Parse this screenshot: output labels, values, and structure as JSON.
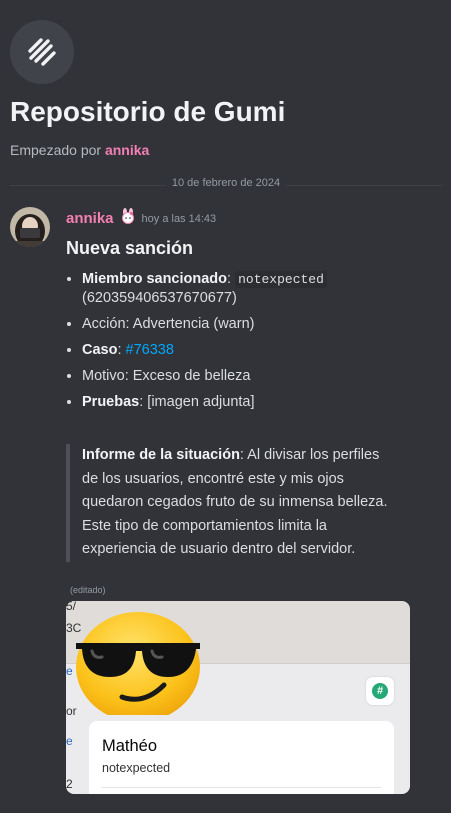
{
  "thread": {
    "title": "Repositorio de Gumi",
    "started_prefix": "Empezado por ",
    "started_author": "annika"
  },
  "divider_date": "10 de febrero de 2024",
  "message": {
    "author": "annika",
    "timestamp": "hoy a las 14:43",
    "heading": "Nueva sanción",
    "items": [
      {
        "label": "Miembro sancionado",
        "sep": ":",
        "code": "notexpected",
        "extra": "(620359406537670677)"
      },
      {
        "text": "Acción: Advertencia (warn)"
      },
      {
        "label": "Caso",
        "sep": ": ",
        "link": "#76338"
      },
      {
        "text": "Motivo: Exceso de belleza"
      },
      {
        "label": "Pruebas",
        "sep": ": ",
        "text": "[imagen adjunta]"
      }
    ],
    "quote": {
      "label": "Informe de la situación",
      "text": ": Al divisar los perfiles de los usuarios, encontré este y mis ojos quedaron cegados fruto de su inmensa belleza. Este tipo de comportamientos limita la experiencia de usuario dentro del servidor."
    },
    "edited": "(editado)"
  },
  "attachment": {
    "ghost_text": [
      "5/",
      "3C",
      "e",
      "or",
      "e",
      "2"
    ],
    "hash_symbol": "#",
    "card_name": "Mathéo",
    "card_username": "notexpected",
    "emoji": "sunglasses-face"
  },
  "colors": {
    "background": "#313338",
    "username": "#f47fb4",
    "link": "#00a8fc"
  }
}
